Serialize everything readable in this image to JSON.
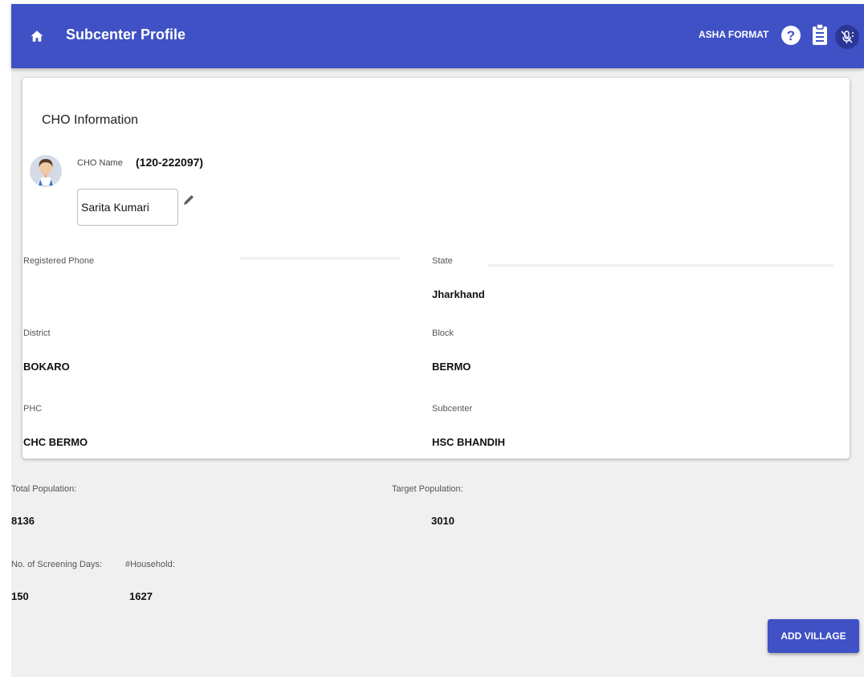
{
  "appbar": {
    "title": "Subcenter Profile",
    "asha_format": "ASHA FORMAT",
    "color": "#3f51c4"
  },
  "card": {
    "title": "CHO Information",
    "cho_name_label": "CHO Name",
    "cho_id": "(120-222097)",
    "cho_name_value": "Sarita Kumari",
    "fields": {
      "registered_phone": {
        "label": "Registered Phone",
        "value": ""
      },
      "state": {
        "label": "State",
        "value": "Jharkhand"
      },
      "district": {
        "label": "District",
        "value": "BOKARO"
      },
      "block": {
        "label": "Block",
        "value": "BERMO"
      },
      "phc": {
        "label": "PHC",
        "value": "CHC BERMO"
      },
      "subcenter": {
        "label": "Subcenter",
        "value": "HSC BHANDIH"
      }
    }
  },
  "stats": {
    "total_population": {
      "label": "Total Population:",
      "value": "8136"
    },
    "target_population": {
      "label": "Target Population:",
      "value": "3010"
    },
    "screening_days": {
      "label": "No. of Screening Days:",
      "value": "150"
    },
    "household": {
      "label": "#Household:",
      "value": "1627"
    }
  },
  "actions": {
    "add_village": "ADD VILLAGE"
  },
  "icons": {
    "home": "home-icon",
    "help": "help-icon",
    "clipboard": "clipboard-icon",
    "mic": "mic-off-icon",
    "edit": "pencil-icon",
    "avatar": "avatar-icon"
  }
}
